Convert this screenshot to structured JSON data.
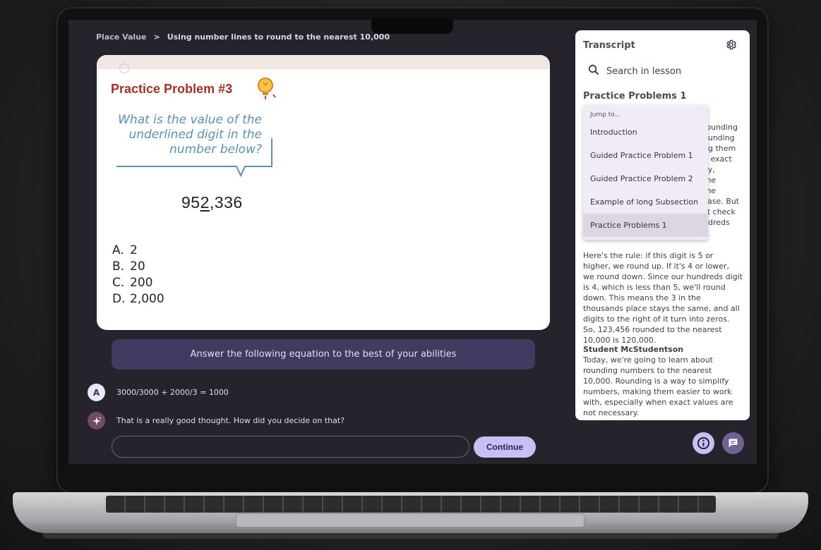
{
  "breadcrumb": {
    "parent": "Place Value",
    "separator": ">",
    "current": "Using number lines to round to the nearest 10,000"
  },
  "problem": {
    "title": "Practice Problem #3",
    "question": "What is the value of the underlined digit in the number below?",
    "number_prefix": "95",
    "number_underlined": "2",
    "number_suffix": ",336",
    "options": [
      {
        "letter": "A.",
        "value": "2"
      },
      {
        "letter": "B.",
        "value": "20"
      },
      {
        "letter": "C.",
        "value": "200"
      },
      {
        "letter": "D.",
        "value": "2,000"
      }
    ]
  },
  "instruction": "Answer the following equation to the best of your abilities",
  "chat": {
    "user_avatar": "A",
    "user_message": "3000/3000 + 2000/3 = 1000",
    "ai_message": "That is a really good thought. How did you decide on that?"
  },
  "answer_input": {
    "value": ""
  },
  "continue_label": "Continue",
  "transcript": {
    "title": "Transcript",
    "search_placeholder": "Search in lesson",
    "section_title": "Practice Problems 1",
    "jump_label": "Jump to...",
    "jump_items": [
      "Introduction",
      "Guided Practice Problem 1",
      "Guided Practice Problem 2",
      "Example of long Subsection",
      "Practice Problems 1"
    ],
    "hidden_lines": [
      "rounding",
      "ounding",
      "ng them",
      "n exact",
      "ay,",
      "the",
      "the",
      "case. But",
      "st check",
      "ndreds"
    ],
    "paragraph_rule": "Here's the rule: if this digit is 5 or higher, we round up. If it's 4 or lower, we round down. Since our hundreds digit is 4, which is less than 5, we'll round down. This means the 3 in the thousands place stays the same, and all digits to the right of it turn into zeros. So, 123,456 rounded to the nearest 10,000 is 120,000.",
    "speaker": "Student McStudentson",
    "paragraph_student": "Today, we're going to learn about rounding numbers to the nearest 10,000. Rounding is a way to simplify numbers, making them easier to work with, especially when exact values are not necessary."
  },
  "icons": {
    "settings": "gear-icon",
    "search": "search-icon",
    "info": "info-icon",
    "chat": "chat-icon",
    "bulb": "lightbulb-icon",
    "ai": "sparkle-icon"
  },
  "colors": {
    "screen_bg": "#26232d",
    "title_red": "#a2312b",
    "question_blue": "#5e8fb3",
    "instruction_bg": "#433a62",
    "continue_bg": "#c9bff2"
  }
}
